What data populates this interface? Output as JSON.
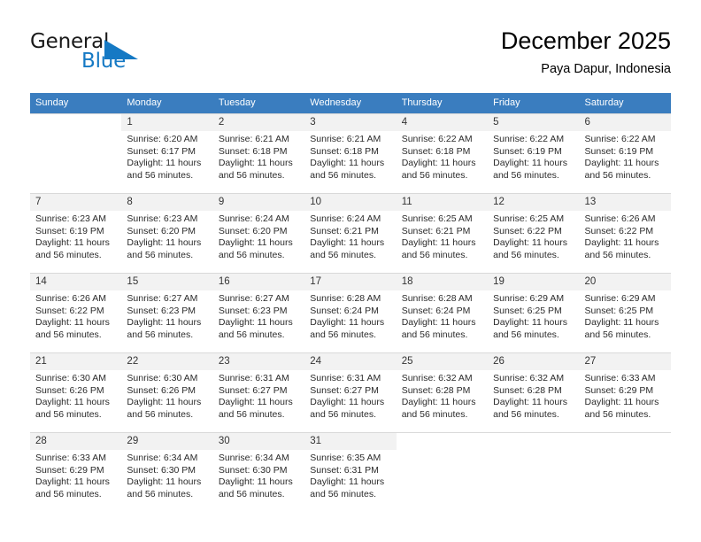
{
  "brand": {
    "name_part1": "General",
    "name_part2": "Blue",
    "flag_color": "#1579c4",
    "logo_icon": "flag-triangle-icon"
  },
  "header": {
    "title": "December 2025",
    "subtitle": "Paya Dapur, Indonesia"
  },
  "theme": {
    "header_row_bg": "#3a7dbf",
    "daynum_bg": "#f2f2f2",
    "text_color": "#2b2b2b",
    "accent": "#1579c4"
  },
  "calendar": {
    "weekday_headers": [
      "Sunday",
      "Monday",
      "Tuesday",
      "Wednesday",
      "Thursday",
      "Friday",
      "Saturday"
    ],
    "weeks": [
      [
        {
          "day": "",
          "sunrise": "",
          "sunset": "",
          "daylight_line1": "",
          "daylight_line2": ""
        },
        {
          "day": "1",
          "sunrise": "Sunrise: 6:20 AM",
          "sunset": "Sunset: 6:17 PM",
          "daylight_line1": "Daylight: 11 hours",
          "daylight_line2": "and 56 minutes."
        },
        {
          "day": "2",
          "sunrise": "Sunrise: 6:21 AM",
          "sunset": "Sunset: 6:18 PM",
          "daylight_line1": "Daylight: 11 hours",
          "daylight_line2": "and 56 minutes."
        },
        {
          "day": "3",
          "sunrise": "Sunrise: 6:21 AM",
          "sunset": "Sunset: 6:18 PM",
          "daylight_line1": "Daylight: 11 hours",
          "daylight_line2": "and 56 minutes."
        },
        {
          "day": "4",
          "sunrise": "Sunrise: 6:22 AM",
          "sunset": "Sunset: 6:18 PM",
          "daylight_line1": "Daylight: 11 hours",
          "daylight_line2": "and 56 minutes."
        },
        {
          "day": "5",
          "sunrise": "Sunrise: 6:22 AM",
          "sunset": "Sunset: 6:19 PM",
          "daylight_line1": "Daylight: 11 hours",
          "daylight_line2": "and 56 minutes."
        },
        {
          "day": "6",
          "sunrise": "Sunrise: 6:22 AM",
          "sunset": "Sunset: 6:19 PM",
          "daylight_line1": "Daylight: 11 hours",
          "daylight_line2": "and 56 minutes."
        }
      ],
      [
        {
          "day": "7",
          "sunrise": "Sunrise: 6:23 AM",
          "sunset": "Sunset: 6:19 PM",
          "daylight_line1": "Daylight: 11 hours",
          "daylight_line2": "and 56 minutes."
        },
        {
          "day": "8",
          "sunrise": "Sunrise: 6:23 AM",
          "sunset": "Sunset: 6:20 PM",
          "daylight_line1": "Daylight: 11 hours",
          "daylight_line2": "and 56 minutes."
        },
        {
          "day": "9",
          "sunrise": "Sunrise: 6:24 AM",
          "sunset": "Sunset: 6:20 PM",
          "daylight_line1": "Daylight: 11 hours",
          "daylight_line2": "and 56 minutes."
        },
        {
          "day": "10",
          "sunrise": "Sunrise: 6:24 AM",
          "sunset": "Sunset: 6:21 PM",
          "daylight_line1": "Daylight: 11 hours",
          "daylight_line2": "and 56 minutes."
        },
        {
          "day": "11",
          "sunrise": "Sunrise: 6:25 AM",
          "sunset": "Sunset: 6:21 PM",
          "daylight_line1": "Daylight: 11 hours",
          "daylight_line2": "and 56 minutes."
        },
        {
          "day": "12",
          "sunrise": "Sunrise: 6:25 AM",
          "sunset": "Sunset: 6:22 PM",
          "daylight_line1": "Daylight: 11 hours",
          "daylight_line2": "and 56 minutes."
        },
        {
          "day": "13",
          "sunrise": "Sunrise: 6:26 AM",
          "sunset": "Sunset: 6:22 PM",
          "daylight_line1": "Daylight: 11 hours",
          "daylight_line2": "and 56 minutes."
        }
      ],
      [
        {
          "day": "14",
          "sunrise": "Sunrise: 6:26 AM",
          "sunset": "Sunset: 6:22 PM",
          "daylight_line1": "Daylight: 11 hours",
          "daylight_line2": "and 56 minutes."
        },
        {
          "day": "15",
          "sunrise": "Sunrise: 6:27 AM",
          "sunset": "Sunset: 6:23 PM",
          "daylight_line1": "Daylight: 11 hours",
          "daylight_line2": "and 56 minutes."
        },
        {
          "day": "16",
          "sunrise": "Sunrise: 6:27 AM",
          "sunset": "Sunset: 6:23 PM",
          "daylight_line1": "Daylight: 11 hours",
          "daylight_line2": "and 56 minutes."
        },
        {
          "day": "17",
          "sunrise": "Sunrise: 6:28 AM",
          "sunset": "Sunset: 6:24 PM",
          "daylight_line1": "Daylight: 11 hours",
          "daylight_line2": "and 56 minutes."
        },
        {
          "day": "18",
          "sunrise": "Sunrise: 6:28 AM",
          "sunset": "Sunset: 6:24 PM",
          "daylight_line1": "Daylight: 11 hours",
          "daylight_line2": "and 56 minutes."
        },
        {
          "day": "19",
          "sunrise": "Sunrise: 6:29 AM",
          "sunset": "Sunset: 6:25 PM",
          "daylight_line1": "Daylight: 11 hours",
          "daylight_line2": "and 56 minutes."
        },
        {
          "day": "20",
          "sunrise": "Sunrise: 6:29 AM",
          "sunset": "Sunset: 6:25 PM",
          "daylight_line1": "Daylight: 11 hours",
          "daylight_line2": "and 56 minutes."
        }
      ],
      [
        {
          "day": "21",
          "sunrise": "Sunrise: 6:30 AM",
          "sunset": "Sunset: 6:26 PM",
          "daylight_line1": "Daylight: 11 hours",
          "daylight_line2": "and 56 minutes."
        },
        {
          "day": "22",
          "sunrise": "Sunrise: 6:30 AM",
          "sunset": "Sunset: 6:26 PM",
          "daylight_line1": "Daylight: 11 hours",
          "daylight_line2": "and 56 minutes."
        },
        {
          "day": "23",
          "sunrise": "Sunrise: 6:31 AM",
          "sunset": "Sunset: 6:27 PM",
          "daylight_line1": "Daylight: 11 hours",
          "daylight_line2": "and 56 minutes."
        },
        {
          "day": "24",
          "sunrise": "Sunrise: 6:31 AM",
          "sunset": "Sunset: 6:27 PM",
          "daylight_line1": "Daylight: 11 hours",
          "daylight_line2": "and 56 minutes."
        },
        {
          "day": "25",
          "sunrise": "Sunrise: 6:32 AM",
          "sunset": "Sunset: 6:28 PM",
          "daylight_line1": "Daylight: 11 hours",
          "daylight_line2": "and 56 minutes."
        },
        {
          "day": "26",
          "sunrise": "Sunrise: 6:32 AM",
          "sunset": "Sunset: 6:28 PM",
          "daylight_line1": "Daylight: 11 hours",
          "daylight_line2": "and 56 minutes."
        },
        {
          "day": "27",
          "sunrise": "Sunrise: 6:33 AM",
          "sunset": "Sunset: 6:29 PM",
          "daylight_line1": "Daylight: 11 hours",
          "daylight_line2": "and 56 minutes."
        }
      ],
      [
        {
          "day": "28",
          "sunrise": "Sunrise: 6:33 AM",
          "sunset": "Sunset: 6:29 PM",
          "daylight_line1": "Daylight: 11 hours",
          "daylight_line2": "and 56 minutes."
        },
        {
          "day": "29",
          "sunrise": "Sunrise: 6:34 AM",
          "sunset": "Sunset: 6:30 PM",
          "daylight_line1": "Daylight: 11 hours",
          "daylight_line2": "and 56 minutes."
        },
        {
          "day": "30",
          "sunrise": "Sunrise: 6:34 AM",
          "sunset": "Sunset: 6:30 PM",
          "daylight_line1": "Daylight: 11 hours",
          "daylight_line2": "and 56 minutes."
        },
        {
          "day": "31",
          "sunrise": "Sunrise: 6:35 AM",
          "sunset": "Sunset: 6:31 PM",
          "daylight_line1": "Daylight: 11 hours",
          "daylight_line2": "and 56 minutes."
        },
        {
          "day": "",
          "sunrise": "",
          "sunset": "",
          "daylight_line1": "",
          "daylight_line2": ""
        },
        {
          "day": "",
          "sunrise": "",
          "sunset": "",
          "daylight_line1": "",
          "daylight_line2": ""
        },
        {
          "day": "",
          "sunrise": "",
          "sunset": "",
          "daylight_line1": "",
          "daylight_line2": ""
        }
      ]
    ]
  }
}
